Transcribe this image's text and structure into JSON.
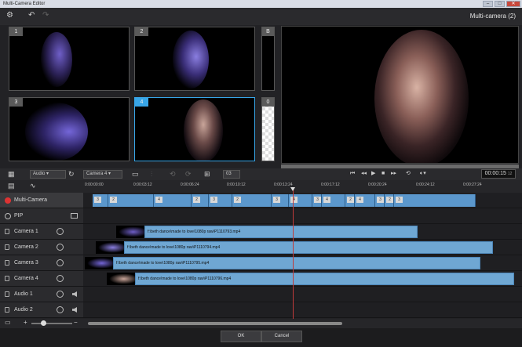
{
  "window": {
    "title": "Multi-Camera Editor",
    "mode_label": "Multi-camera (2)"
  },
  "cameras": [
    {
      "num": "1"
    },
    {
      "num": "2"
    },
    {
      "num": "3"
    },
    {
      "num": "4"
    }
  ],
  "side_slots": {
    "b": "B",
    "zero": "0"
  },
  "controls": {
    "audio_select": "Audio",
    "camera_select": "Camera 4",
    "transition_value": "03"
  },
  "timecode": "00:00:15",
  "timecode_suffix": "12",
  "ruler_ticks": [
    "0:00:00:00",
    "0:00:03:12",
    "0:00:06:24",
    "0:00:10:12",
    "0:00:13:24",
    "0:00:17:12",
    "0:00:20:24",
    "0:00:24:12",
    "0:00:27:24"
  ],
  "tracks": {
    "multicam": "Multi-Camera",
    "pip": "PIP",
    "camera1": "Camera 1",
    "camera2": "Camera 2",
    "camera3": "Camera 3",
    "camera4": "Camera 4",
    "audio1": "Audio 1",
    "audio2": "Audio 2"
  },
  "multicam_segments": [
    "3",
    "2",
    "4",
    "2",
    "3",
    "2",
    "3",
    "4",
    "3",
    "4",
    "2",
    "4",
    "3",
    "2",
    "3"
  ],
  "clips": {
    "camera1": "f:\\beth dance\\made to love\\1080p raw\\P1110793.mp4",
    "camera2": "f:\\beth dance\\made to love\\1080p raw\\P1110794.mp4",
    "camera3": "f:\\beth dance\\made to love\\1080p raw\\P1110795.mp4",
    "camera4": "f:\\beth dance\\made to love\\1080p raw\\P1110796.mp4"
  },
  "footer": {
    "ok": "OK",
    "cancel": "Cancel"
  }
}
